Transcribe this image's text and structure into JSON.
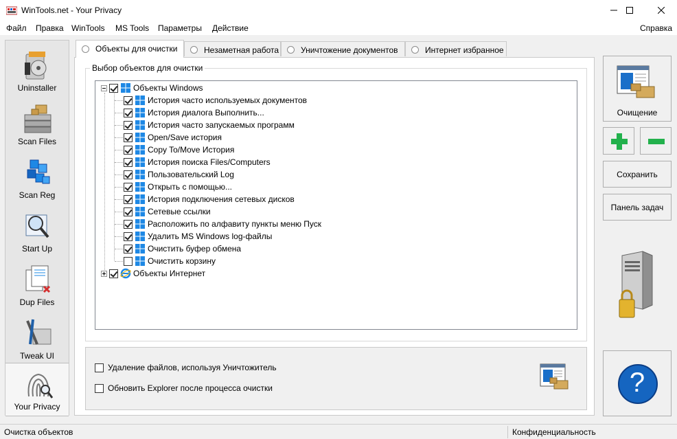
{
  "window": {
    "title": "WinTools.net - Your Privacy"
  },
  "menu": {
    "items": [
      "Файл",
      "Правка",
      "WinTools",
      "MS Tools",
      "Параметры",
      "Действие"
    ],
    "help": "Справка"
  },
  "sidebar": {
    "items": [
      {
        "label": "Uninstaller",
        "icon": "uninstaller-icon"
      },
      {
        "label": "Scan Files",
        "icon": "scan-files-icon"
      },
      {
        "label": "Scan Reg",
        "icon": "scan-reg-icon"
      },
      {
        "label": "Start Up",
        "icon": "start-up-icon"
      },
      {
        "label": "Dup Files",
        "icon": "dup-files-icon"
      },
      {
        "label": "Tweak UI",
        "icon": "tweak-ui-icon"
      },
      {
        "label": "Your Privacy",
        "icon": "your-privacy-icon"
      }
    ],
    "active": "Your Privacy"
  },
  "tabs": [
    {
      "label": "Объекты для очистки",
      "active": true
    },
    {
      "label": "Незаметная работа",
      "active": false
    },
    {
      "label": "Уничтожение документов",
      "active": false
    },
    {
      "label": "Интернет избранное",
      "active": false
    }
  ],
  "group": {
    "title": "Выбор объектов для очистки"
  },
  "tree": {
    "windows": {
      "label": "Объекты Windows",
      "checked": true,
      "children": [
        {
          "label": "История часто используемых документов",
          "checked": true
        },
        {
          "label": "История диалога Выполнить...",
          "checked": true
        },
        {
          "label": "История часто запускаемых программ",
          "checked": true
        },
        {
          "label": "Open/Save история",
          "checked": true
        },
        {
          "label": "Copy To/Move История",
          "checked": true
        },
        {
          "label": "История поиска Files/Computers",
          "checked": true
        },
        {
          "label": "Пользовательский Log",
          "checked": true
        },
        {
          "label": "Открыть с помощью...",
          "checked": true
        },
        {
          "label": "История подключения сетевых дисков",
          "checked": true
        },
        {
          "label": "Сетевые ссылки",
          "checked": true
        },
        {
          "label": "Расположить по алфавиту пункты меню Пуск",
          "checked": true
        },
        {
          "label": "Удалить MS Windows log-файлы",
          "checked": true
        },
        {
          "label": "Очистить буфер обмена",
          "checked": true
        },
        {
          "label": "Очистить корзину",
          "checked": false
        }
      ]
    },
    "internet": {
      "label": "Объекты Интернет",
      "checked": true
    }
  },
  "options": [
    {
      "label": "Удаление файлов, используя Уничтожитель",
      "checked": false
    },
    {
      "label": "Обновить Explorer после процесса очистки",
      "checked": false
    }
  ],
  "right": {
    "clean_label": "Очищение",
    "save_label": "Сохранить",
    "taskbar_label": "Панель задач",
    "help_glyph": "?"
  },
  "status": {
    "left": "Очистка объектов",
    "right": "Конфиденциальность"
  },
  "colors": {
    "accent_blue": "#1a6fc9",
    "plus_green": "#22b14c",
    "help_blue": "#1565c0"
  }
}
